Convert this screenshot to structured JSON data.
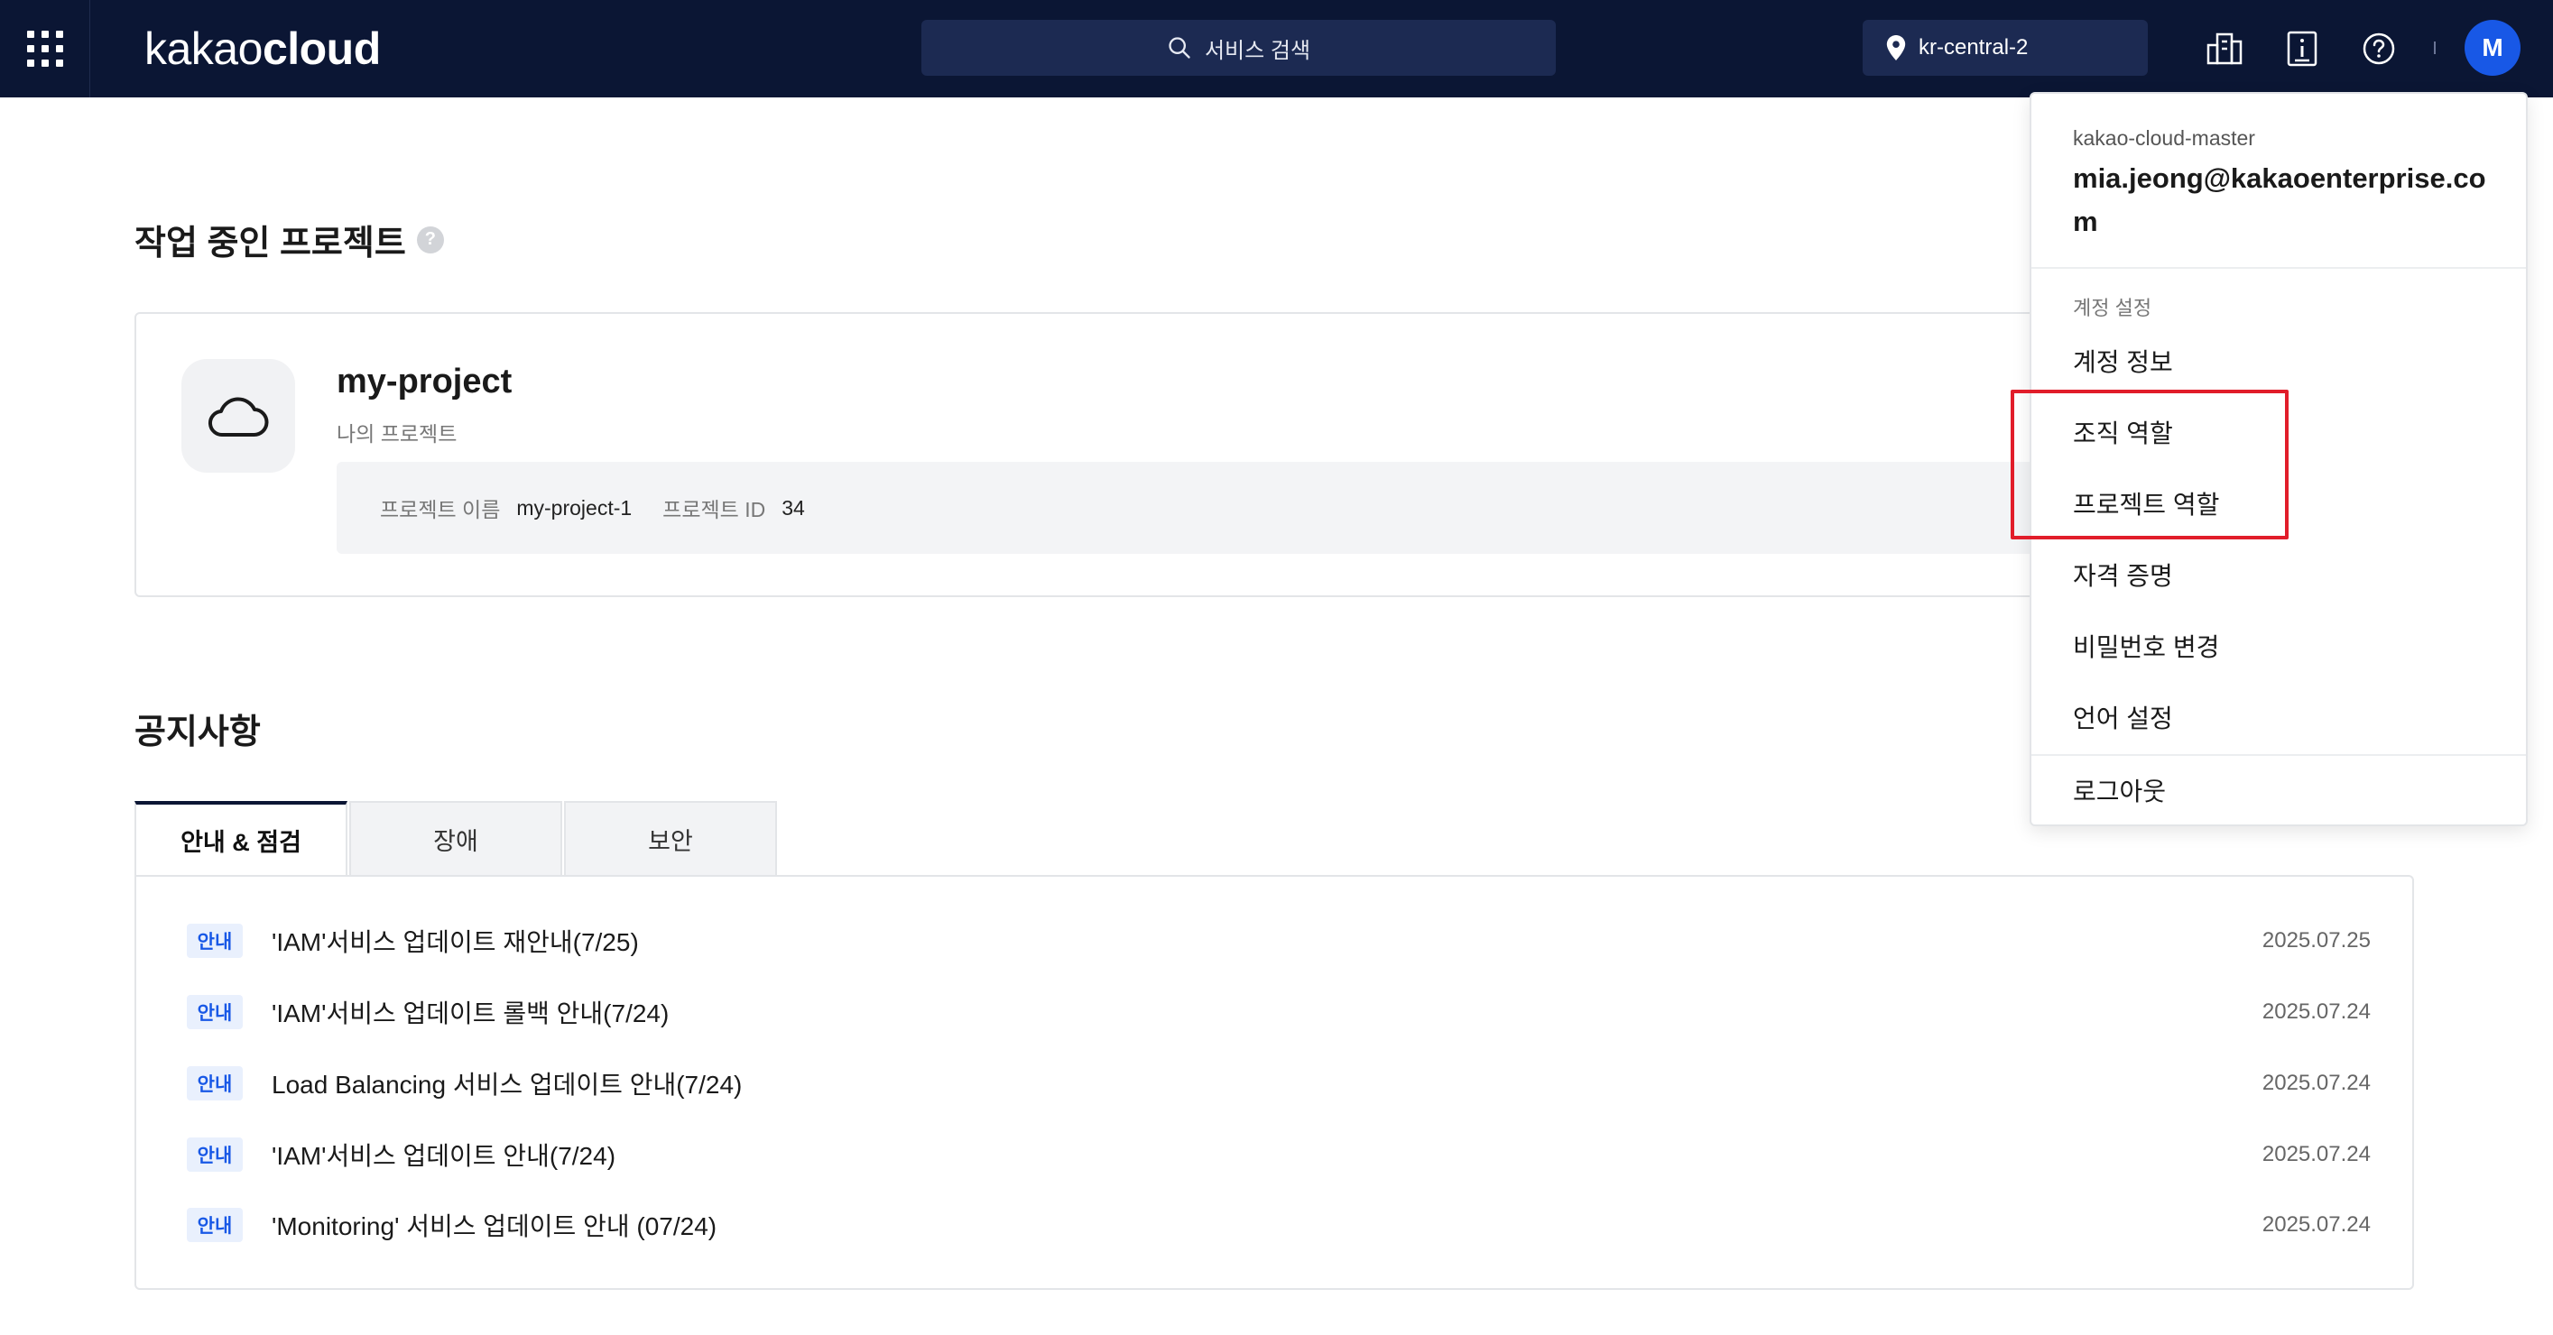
{
  "header": {
    "logo_light": "kakao",
    "logo_bold": "cloud",
    "search_placeholder": "서비스 검색",
    "region": "kr-central-2",
    "avatar_initial": "M"
  },
  "project_section": {
    "title": "작업 중인 프로젝트",
    "help_icon": "?",
    "project_name": "my-project",
    "project_subtitle": "나의 프로젝트",
    "meta_name_label": "프로젝트 이름",
    "meta_name_value": "my-project-1",
    "meta_id_label": "프로젝트 ID",
    "meta_id_value": "34"
  },
  "notices": {
    "title": "공지사항",
    "tabs": [
      {
        "label": "안내 & 점검",
        "active": true
      },
      {
        "label": "장애",
        "active": false
      },
      {
        "label": "보안",
        "active": false
      }
    ],
    "items": [
      {
        "badge": "안내",
        "title": "'IAM'서비스 업데이트 재안내(7/25)",
        "date": "2025.07.25"
      },
      {
        "badge": "안내",
        "title": "'IAM'서비스 업데이트 롤백 안내(7/24)",
        "date": "2025.07.24"
      },
      {
        "badge": "안내",
        "title": "Load Balancing 서비스 업데이트 안내(7/24)",
        "date": "2025.07.24"
      },
      {
        "badge": "안내",
        "title": "'IAM'서비스 업데이트 안내(7/24)",
        "date": "2025.07.24"
      },
      {
        "badge": "안내",
        "title": "'Monitoring' 서비스 업데이트 안내 (07/24)",
        "date": "2025.07.24"
      }
    ]
  },
  "account_menu": {
    "org": "kakao-cloud-master",
    "email": "mia.jeong@kakaoenterprise.com",
    "section_label": "계정 설정",
    "items": [
      "계정 정보",
      "조직 역할",
      "프로젝트 역할",
      "자격 증명",
      "비밀번호 변경",
      "언어 설정"
    ],
    "logout": "로그아웃"
  },
  "colors": {
    "header_bg": "#0b1634",
    "accent": "#1858e6",
    "highlight": "#e11d2a"
  }
}
